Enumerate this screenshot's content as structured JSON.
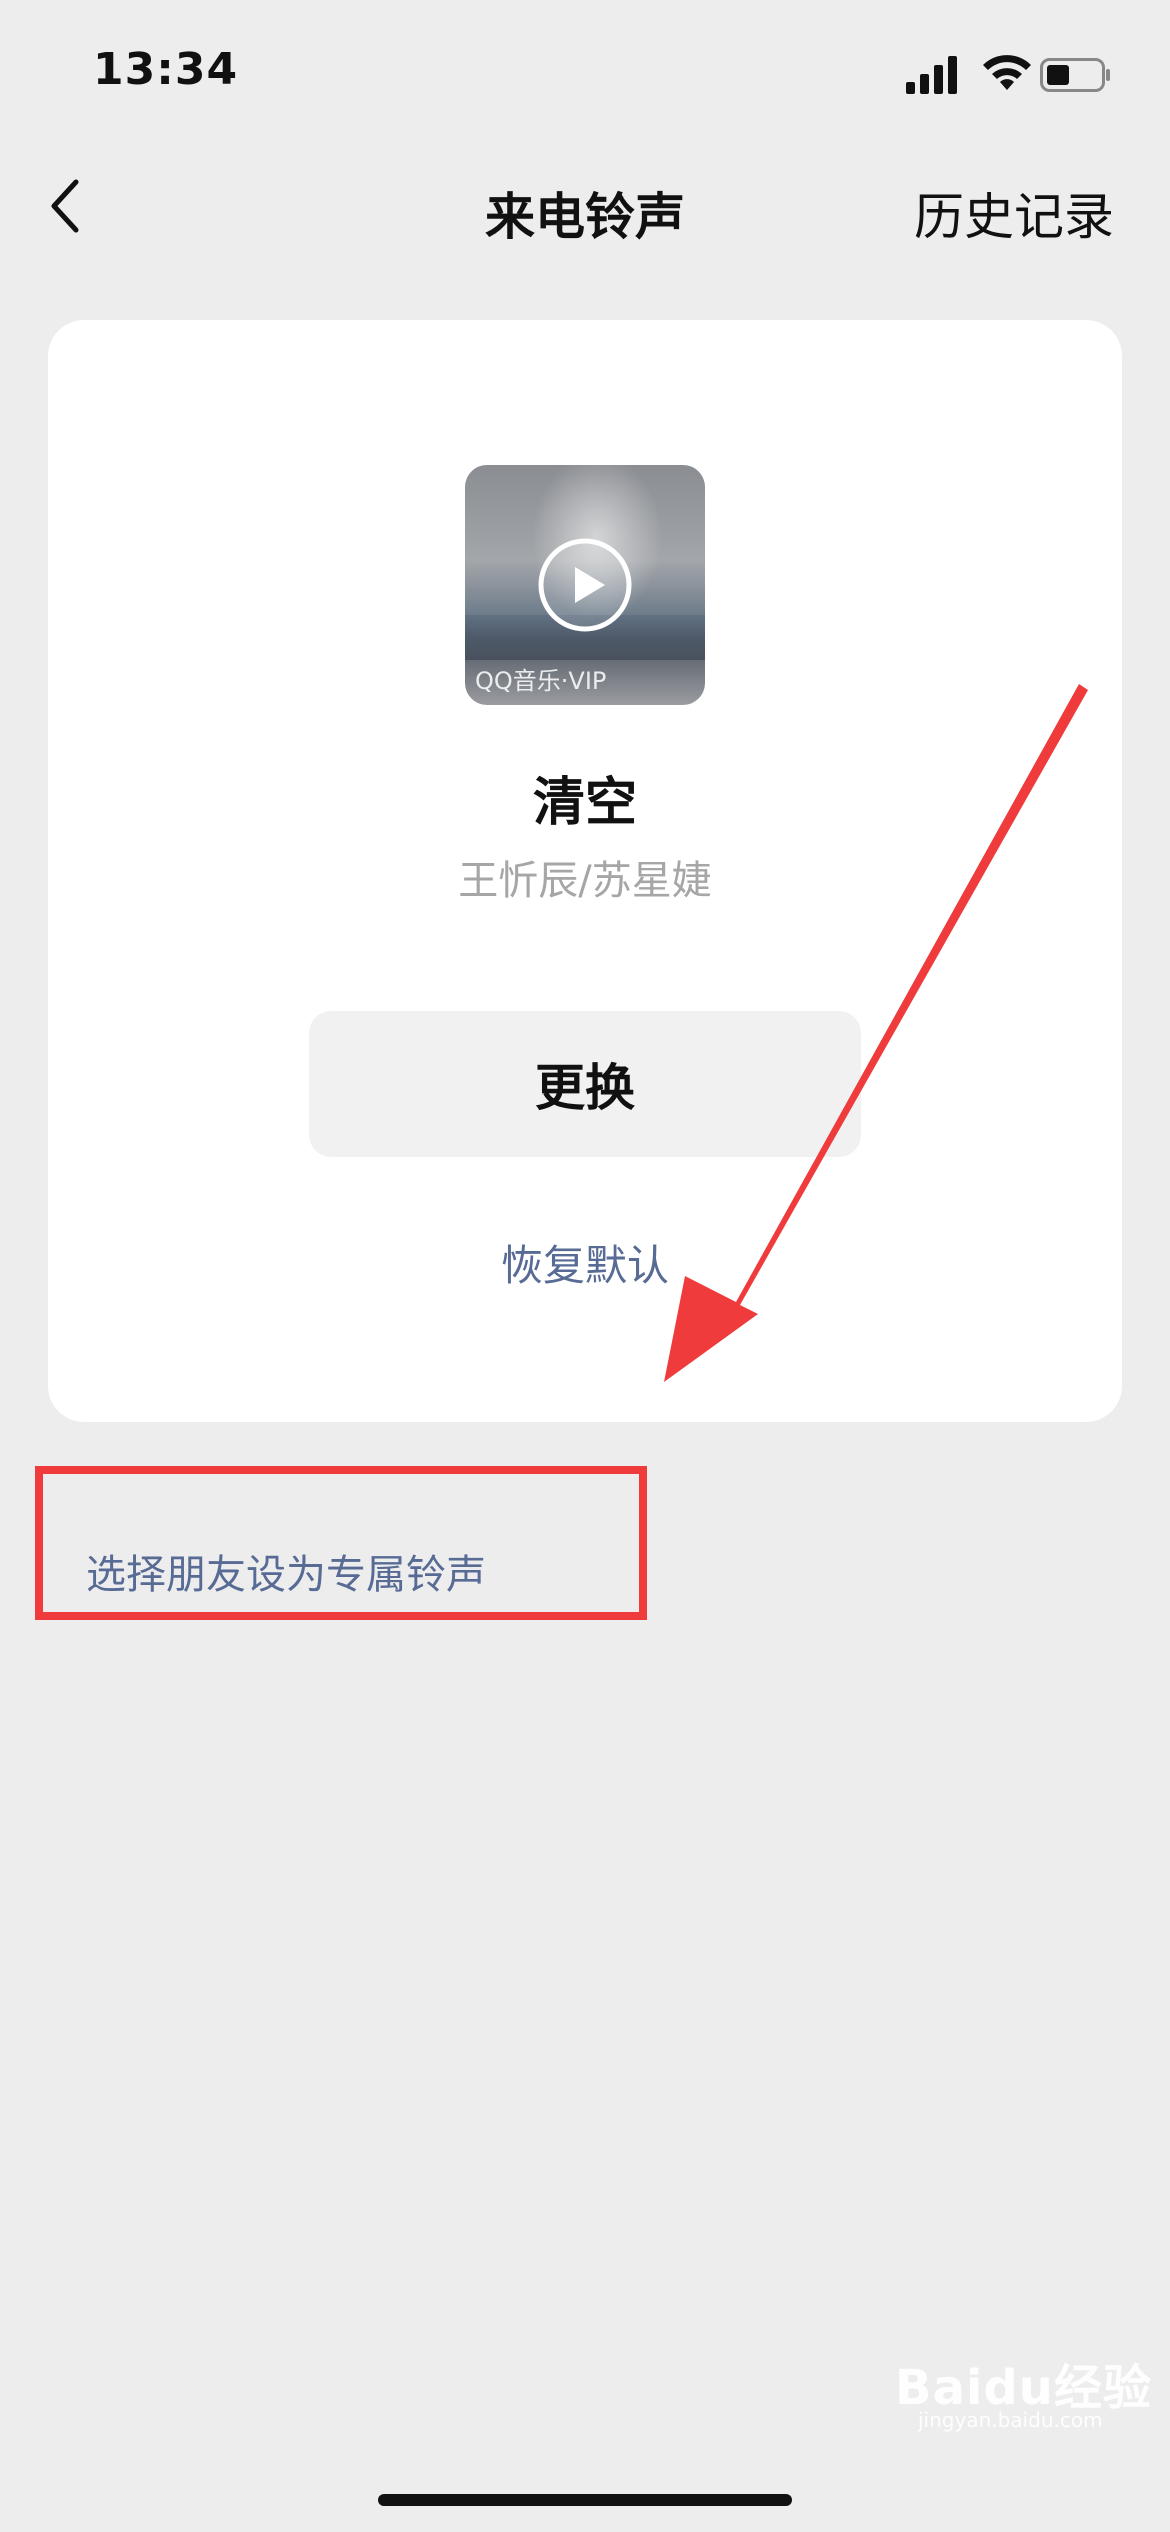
{
  "status_bar": {
    "time": "13:34"
  },
  "nav": {
    "title": "来电铃声",
    "history": "历史记录"
  },
  "song": {
    "title": "清空",
    "artist": "王忻辰/苏星婕",
    "cover_badge": "QQ音乐·VIP"
  },
  "actions": {
    "change": "更换",
    "restore_default": "恢复默认",
    "friend_ringtone": "选择朋友设为专属铃声"
  },
  "watermark": {
    "brand": "Baidu经验",
    "url": "jingyan.baidu.com"
  },
  "colors": {
    "background": "#ededed",
    "link": "#576b95",
    "annotation_red": "#ef3b3b"
  },
  "icons": [
    "signal-icon",
    "wifi-icon",
    "battery-icon",
    "back-chevron-icon",
    "play-icon"
  ]
}
